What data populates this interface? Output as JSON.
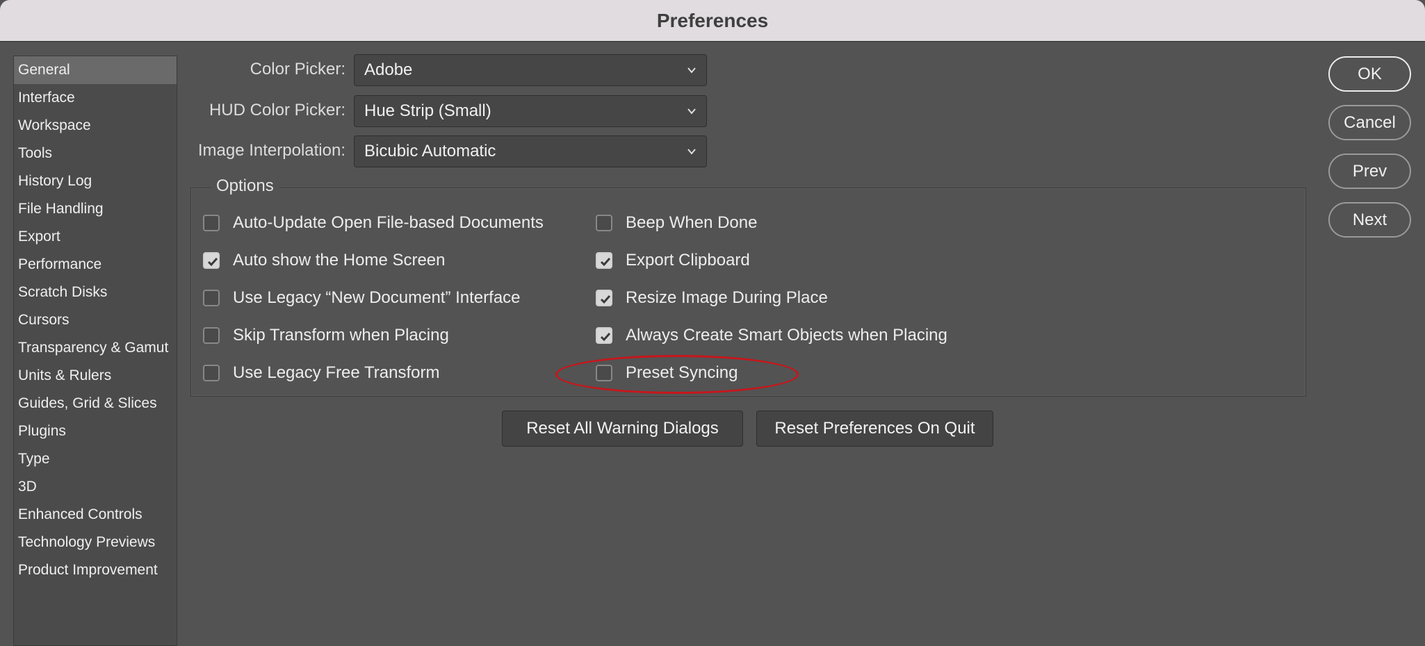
{
  "window": {
    "title": "Preferences"
  },
  "sidebar": {
    "items": [
      {
        "label": "General",
        "active": true
      },
      {
        "label": "Interface"
      },
      {
        "label": "Workspace"
      },
      {
        "label": "Tools"
      },
      {
        "label": "History Log"
      },
      {
        "label": "File Handling"
      },
      {
        "label": "Export"
      },
      {
        "label": "Performance"
      },
      {
        "label": "Scratch Disks"
      },
      {
        "label": "Cursors"
      },
      {
        "label": "Transparency & Gamut"
      },
      {
        "label": "Units & Rulers"
      },
      {
        "label": "Guides, Grid & Slices"
      },
      {
        "label": "Plugins"
      },
      {
        "label": "Type"
      },
      {
        "label": "3D"
      },
      {
        "label": "Enhanced Controls"
      },
      {
        "label": "Technology Previews"
      },
      {
        "label": "Product Improvement"
      }
    ]
  },
  "fields": {
    "color_picker": {
      "label": "Color Picker:",
      "value": "Adobe"
    },
    "hud_color_picker": {
      "label": "HUD Color Picker:",
      "value": "Hue Strip (Small)"
    },
    "image_interpolation": {
      "label": "Image Interpolation:",
      "value": "Bicubic Automatic"
    }
  },
  "options": {
    "legend": "Options",
    "left": [
      {
        "label": "Auto-Update Open File-based Documents",
        "checked": false
      },
      {
        "label": "Auto show the Home Screen",
        "checked": true
      },
      {
        "label": "Use Legacy “New Document” Interface",
        "checked": false
      },
      {
        "label": "Skip Transform when Placing",
        "checked": false
      },
      {
        "label": "Use Legacy Free Transform",
        "checked": false
      }
    ],
    "right": [
      {
        "label": "Beep When Done",
        "checked": false
      },
      {
        "label": "Export Clipboard",
        "checked": true
      },
      {
        "label": "Resize Image During Place",
        "checked": true
      },
      {
        "label": "Always Create Smart Objects when Placing",
        "checked": true
      },
      {
        "label": "Preset Syncing",
        "checked": false
      }
    ]
  },
  "buttons": {
    "reset_warnings": "Reset All Warning Dialogs",
    "reset_prefs": "Reset Preferences On Quit",
    "ok": "OK",
    "cancel": "Cancel",
    "prev": "Prev",
    "next": "Next"
  },
  "colors": {
    "background": "#535353",
    "titlebar": "#e1dcdf",
    "annotation": "#c8161b"
  }
}
